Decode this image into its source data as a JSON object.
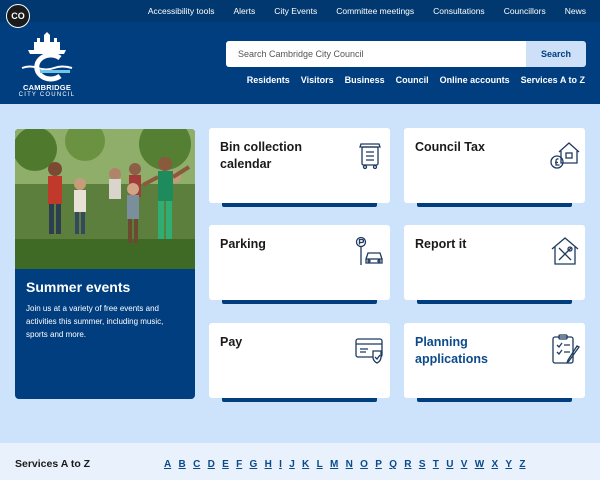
{
  "accessibility_badge": "CO",
  "top_links": [
    "Accessibility tools",
    "Alerts",
    "City Events",
    "Committee meetings",
    "Consultations",
    "Councillors",
    "News"
  ],
  "logo": {
    "line1": "CAMBRIDGE",
    "line2": "CITY  COUNCIL"
  },
  "search": {
    "placeholder": "Search Cambridge City Council",
    "button": "Search"
  },
  "main_nav": [
    "Residents",
    "Visitors",
    "Business",
    "Council",
    "Online accounts",
    "Services A to Z"
  ],
  "feature": {
    "title": "Summer events",
    "text": "Join us at a variety of free events and activities this summer, including music, sports and more."
  },
  "tiles": [
    {
      "title": "Bin collection calendar",
      "icon": "wheelie-bin-icon"
    },
    {
      "title": "Council Tax",
      "icon": "house-pound-icon"
    },
    {
      "title": "Parking",
      "icon": "parking-car-icon"
    },
    {
      "title": "Report it",
      "icon": "tools-house-icon"
    },
    {
      "title": "Pay",
      "icon": "payment-card-icon"
    },
    {
      "title": "Planning applications",
      "icon": "clipboard-pen-icon"
    }
  ],
  "az": {
    "label": "Services A to Z",
    "letters": [
      "A",
      "B",
      "C",
      "D",
      "E",
      "F",
      "G",
      "H",
      "I",
      "J",
      "K",
      "L",
      "M",
      "N",
      "O",
      "P",
      "Q",
      "R",
      "S",
      "T",
      "U",
      "V",
      "W",
      "X",
      "Y",
      "Z"
    ]
  },
  "colors": {
    "navy": "#003e80",
    "topbar": "#00386f",
    "background": "#cde3fb",
    "link": "#0b4a8a"
  }
}
